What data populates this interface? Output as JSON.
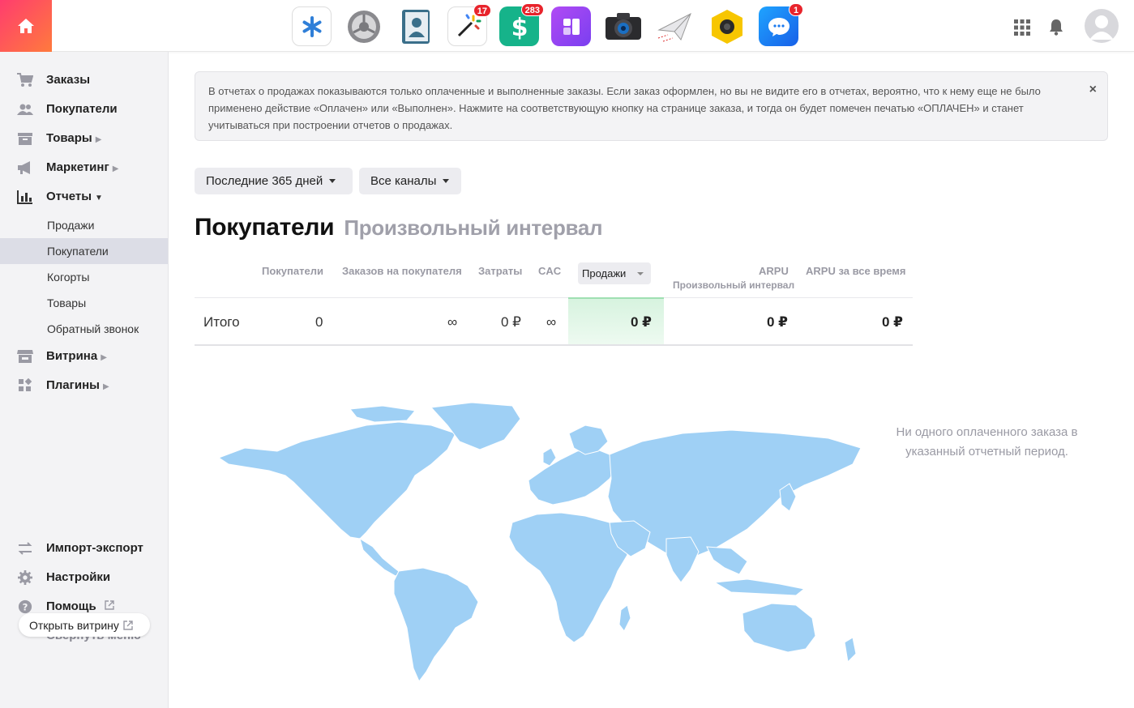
{
  "topbar": {
    "apps": [
      {
        "name": "asterisk-app-icon",
        "badge": ""
      },
      {
        "name": "gear-app-icon",
        "badge": ""
      },
      {
        "name": "contacts-app-icon",
        "badge": ""
      },
      {
        "name": "magic-wand-app-icon",
        "badge": "17"
      },
      {
        "name": "dollar-app-icon",
        "badge": "283"
      },
      {
        "name": "purple-app-icon",
        "badge": ""
      },
      {
        "name": "camera-app-icon",
        "badge": ""
      },
      {
        "name": "paper-plane-app-icon",
        "badge": ""
      },
      {
        "name": "hexagon-app-icon",
        "badge": ""
      },
      {
        "name": "chat-app-icon",
        "badge": "1"
      }
    ]
  },
  "sidebar": {
    "items": [
      {
        "label": "Заказы"
      },
      {
        "label": "Покупатели"
      },
      {
        "label": "Товары"
      },
      {
        "label": "Маркетинг"
      },
      {
        "label": "Отчеты"
      },
      {
        "label": "Витрина"
      },
      {
        "label": "Плагины"
      }
    ],
    "sub_items": [
      {
        "label": "Продажи"
      },
      {
        "label": "Покупатели"
      },
      {
        "label": "Когорты"
      },
      {
        "label": "Товары"
      },
      {
        "label": "Обратный звонок"
      }
    ],
    "bottom_items": [
      {
        "label": "Импорт-экспорт"
      },
      {
        "label": "Настройки"
      },
      {
        "label": "Помощь"
      },
      {
        "label": "Свернуть меню"
      }
    ],
    "storefront_button": "Открыть витрину"
  },
  "info": {
    "text": "В отчетах о продажах показываются только оплаченные и выполненные заказы. Если заказ оформлен, но вы не видите его в отчетах, вероятно, что к нему еще не было применено действие «Оплачен» или «Выполнен». Нажмите на соответствующую кнопку на странице заказа, и тогда он будет помечен печатью «ОПЛАЧЕН» и станет учитываться при построении отчетов о продажах.",
    "close": "×"
  },
  "filters": {
    "period": "Последние 365 дней",
    "channels": "Все каналы"
  },
  "title": {
    "main": "Покупатели",
    "sub": "Произвольный интервал"
  },
  "table": {
    "headers": {
      "customers": "Покупатели",
      "orders_per_customer": "Заказов на покупателя",
      "costs": "Затраты",
      "cac": "CAC",
      "sales": "Продажи",
      "arpu": "ARPU",
      "arpu_sub": "Произвольный интервал",
      "arpu_all": "ARPU за все время"
    },
    "row": {
      "label": "Итого",
      "customers": "0",
      "orders_per_customer": "∞",
      "costs": "0 ₽",
      "cac": "∞",
      "sales": "0 ₽",
      "arpu": "0 ₽",
      "arpu_all": "0 ₽"
    }
  },
  "empty_message": "Ни одного оплаченного заказа в указанный отчетный период.",
  "colors": {
    "accent_gradient_start": "#ff3d6e",
    "accent_gradient_end": "#ff7a3d",
    "map_fill": "#9fd0f5",
    "highlight": "#d7f3df"
  }
}
